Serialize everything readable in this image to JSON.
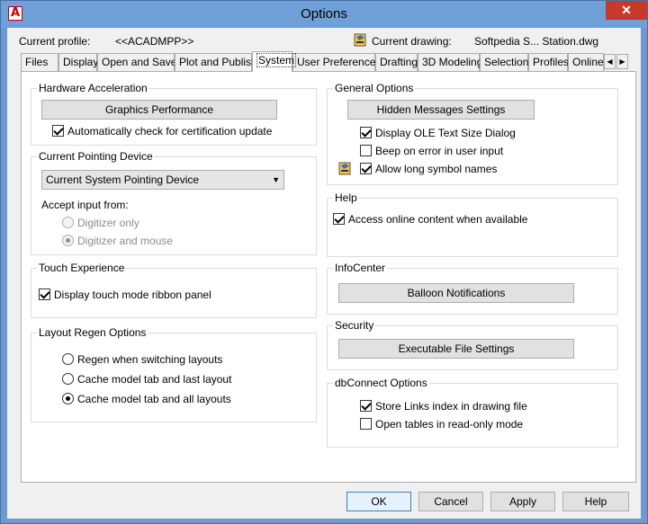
{
  "window": {
    "title": "Options",
    "close_glyph": "✕",
    "app_glyph": "A"
  },
  "profile": {
    "label": "Current profile:",
    "value": "<<ACADMPP>>"
  },
  "drawing": {
    "label": "Current drawing:",
    "value": "Softpedia S... Station.dwg"
  },
  "tabs": [
    "Files",
    "Display",
    "Open and Save",
    "Plot and Publish",
    "System",
    "User Preferences",
    "Drafting",
    "3D Modeling",
    "Selection",
    "Profiles",
    "Online"
  ],
  "tab_scroll": {
    "left": "◀",
    "right": "▶"
  },
  "hardware": {
    "title": "Hardware Acceleration",
    "button": "Graphics Performance",
    "auto_check": "Automatically check for certification update"
  },
  "pointing": {
    "title": "Current Pointing Device",
    "selected": "Current System Pointing Device",
    "accept_label": "Accept input from:",
    "opt1": "Digitizer only",
    "opt2": "Digitizer and mouse"
  },
  "touch": {
    "title": "Touch Experience",
    "check": "Display touch mode ribbon panel"
  },
  "regen": {
    "title": "Layout Regen Options",
    "opt1": "Regen when switching layouts",
    "opt2": "Cache model tab and last layout",
    "opt3": "Cache model tab and all layouts"
  },
  "general": {
    "title": "General Options",
    "button": "Hidden Messages Settings",
    "check1": "Display OLE Text Size Dialog",
    "check2": "Beep on error in user input",
    "check3": "Allow long symbol names"
  },
  "help": {
    "title": "Help",
    "check": "Access online content when available"
  },
  "infocenter": {
    "title": "InfoCenter",
    "button": "Balloon Notifications"
  },
  "security": {
    "title": "Security",
    "button": "Executable File Settings"
  },
  "dbconnect": {
    "title": "dbConnect Options",
    "check1": "Store Links index in drawing file",
    "check2": "Open tables in read-only mode"
  },
  "footer": {
    "ok": "OK",
    "cancel": "Cancel",
    "apply": "Apply",
    "help": "Help"
  },
  "colors": {
    "title_bar": "#6fa0d8",
    "close": "#c7392b",
    "dialog_bg": "#f0f0f0"
  }
}
